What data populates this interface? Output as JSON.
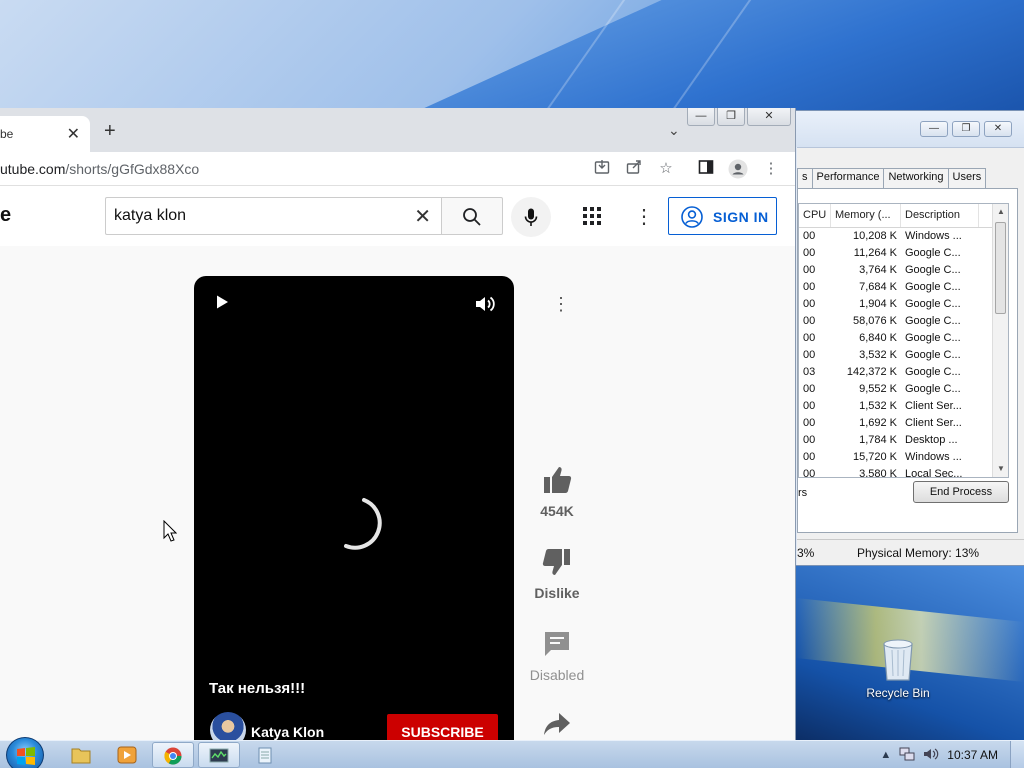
{
  "desktop": {
    "recycle_bin_label": "Recycle Bin"
  },
  "task_manager": {
    "tabs": [
      "s",
      "Performance",
      "Networking",
      "Users"
    ],
    "columns": [
      "CPU",
      "Memory (...",
      "Description"
    ],
    "rows": [
      {
        "cpu": "00",
        "mem": "10,208 K",
        "desc": "Windows ..."
      },
      {
        "cpu": "00",
        "mem": "11,264 K",
        "desc": "Google C..."
      },
      {
        "cpu": "00",
        "mem": "3,764 K",
        "desc": "Google C..."
      },
      {
        "cpu": "00",
        "mem": "7,684 K",
        "desc": "Google C..."
      },
      {
        "cpu": "00",
        "mem": "1,904 K",
        "desc": "Google C..."
      },
      {
        "cpu": "00",
        "mem": "58,076 K",
        "desc": "Google C..."
      },
      {
        "cpu": "00",
        "mem": "6,840 K",
        "desc": "Google C..."
      },
      {
        "cpu": "00",
        "mem": "3,532 K",
        "desc": "Google C..."
      },
      {
        "cpu": "03",
        "mem": "142,372 K",
        "desc": "Google C..."
      },
      {
        "cpu": "00",
        "mem": "9,552 K",
        "desc": "Google C..."
      },
      {
        "cpu": "00",
        "mem": "1,532 K",
        "desc": "Client Ser..."
      },
      {
        "cpu": "00",
        "mem": "1,692 K",
        "desc": "Client Ser..."
      },
      {
        "cpu": "00",
        "mem": "1,784 K",
        "desc": "Desktop ..."
      },
      {
        "cpu": "00",
        "mem": "15,720 K",
        "desc": "Windows ..."
      },
      {
        "cpu": "00",
        "mem": "3,580 K",
        "desc": "Local Sec..."
      }
    ],
    "show_processes_fragment": "rs",
    "end_process_label": "End Process",
    "status_cpu_fragment": "3%",
    "status_memory": "Physical Memory: 13%"
  },
  "browser": {
    "tab_title_fragment": "be",
    "url_host": "utube.com",
    "url_path": "/shorts/gGfGdx88Xco",
    "window_caps": {
      "min": "—",
      "max": "❐",
      "close": "✕"
    }
  },
  "youtube": {
    "logo_fragment": "e",
    "search_value": "katya klon",
    "sign_in_label": "SIGN IN",
    "caption": "Так нельзя!!!",
    "channel_name": "Katya Klon",
    "subscribe_label": "SUBSCRIBE",
    "like_count": "454K",
    "dislike_label": "Dislike",
    "comments_label": "Disabled",
    "colors": {
      "accent": "#065fd4",
      "subscribe": "#cc0000"
    }
  },
  "taskbar": {
    "clock": "10:37 AM"
  }
}
